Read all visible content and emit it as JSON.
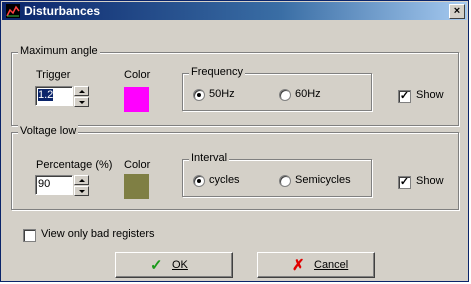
{
  "window": {
    "title": "Disturbances",
    "close_glyph": "×"
  },
  "groups": {
    "max_angle": {
      "title": "Maximum angle",
      "trigger_label": "Trigger",
      "trigger_value": "1.2",
      "color_label": "Color",
      "color_value": "#ff00ff",
      "frequency_title": "Frequency",
      "freq_options": [
        "50Hz",
        "60Hz"
      ],
      "freq_selected": "50Hz",
      "show_label": "Show",
      "show_checked": true
    },
    "voltage_low": {
      "title": "Voltage low",
      "percentage_label": "Percentage (%)",
      "percentage_value": "90",
      "color_label": "Color",
      "color_value": "#7f7f44",
      "interval_title": "Interval",
      "interval_options": [
        "cycles",
        "Semicycles"
      ],
      "interval_selected": "cycles",
      "show_label": "Show",
      "show_checked": true
    }
  },
  "view_only_bad": {
    "label": "View only bad registers",
    "checked": false
  },
  "buttons": {
    "ok": "OK",
    "cancel": "Cancel"
  },
  "icons": {
    "app": "chart-icon",
    "ok": "checkmark-icon",
    "cancel": "x-icon"
  }
}
